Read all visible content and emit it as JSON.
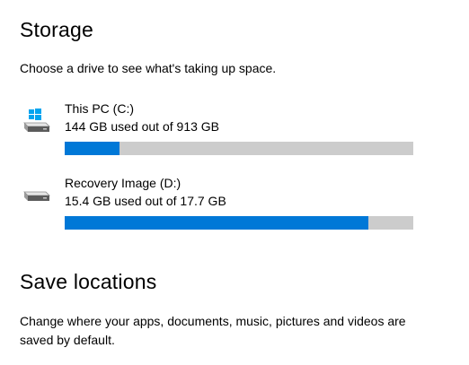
{
  "storage": {
    "heading": "Storage",
    "description": "Choose a drive to see what's taking up space.",
    "drives": [
      {
        "name": "This PC (C:)",
        "usage_text": "144 GB used out of 913 GB",
        "used_fraction": 0.158,
        "icon": "windows-drive-icon"
      },
      {
        "name": "Recovery Image (D:)",
        "usage_text": "15.4 GB used out of 17.7 GB",
        "used_fraction": 0.87,
        "icon": "drive-icon"
      }
    ],
    "bar_fill_color": "#0078d7",
    "bar_track_color": "#cccccc"
  },
  "save_locations": {
    "heading": "Save locations",
    "description": "Change where your apps, documents, music, pictures and videos are saved by default."
  }
}
